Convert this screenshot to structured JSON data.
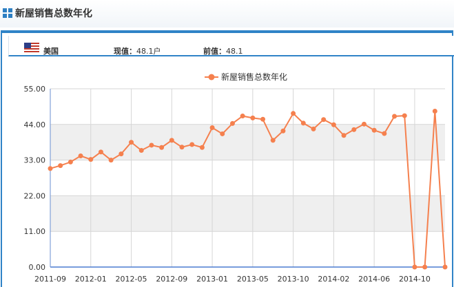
{
  "header": {
    "title": "新屋销售总数年化"
  },
  "info": {
    "country": "美国",
    "current_label": "现值",
    "current_sep": "：",
    "current_value": "48.1户",
    "previous_label": "前值",
    "previous_sep": "：",
    "previous_value": "48.1"
  },
  "chart_data": {
    "type": "line",
    "title": "",
    "xlabel": "",
    "ylabel": "",
    "ylim": [
      0,
      55
    ],
    "yticks": [
      "0.00",
      "11.00",
      "22.00",
      "33.00",
      "44.00",
      "55.00"
    ],
    "xtick_labels": [
      "2011-09",
      "2012-01",
      "2012-05",
      "2012-09",
      "2013-01",
      "2013-05",
      "2013-10",
      "2014-02",
      "2014-06",
      "2014-10"
    ],
    "legend_position": "top-center",
    "grid": true,
    "series_color": "#f5804e",
    "series": [
      {
        "name": "新屋销售总数年化",
        "x": [
          "2011-09",
          "2011-10",
          "2011-11",
          "2011-12",
          "2012-01",
          "2012-02",
          "2012-03",
          "2012-04",
          "2012-05",
          "2012-06",
          "2012-07",
          "2012-08",
          "2012-09",
          "2012-10",
          "2012-11",
          "2012-12",
          "2013-01",
          "2013-02",
          "2013-03",
          "2013-04",
          "2013-05",
          "2013-06",
          "2013-07",
          "2013-08",
          "2013-10",
          "2013-11",
          "2013-12",
          "2014-01",
          "2014-02",
          "2014-03",
          "2014-04",
          "2014-05",
          "2014-06",
          "2014-07",
          "2014-08",
          "2014-09",
          "2014-10",
          "2014-11",
          "2014-12",
          "2015-01"
        ],
        "values": [
          30.4,
          31.3,
          32.4,
          34.3,
          33.2,
          35.5,
          33.0,
          34.9,
          38.5,
          36.0,
          37.6,
          36.9,
          39.1,
          37.0,
          37.8,
          36.9,
          43.0,
          41.1,
          44.3,
          46.6,
          46.0,
          45.6,
          39.1,
          42.0,
          47.4,
          44.4,
          42.6,
          45.5,
          43.9,
          40.6,
          42.4,
          44.1,
          42.2,
          41.2,
          46.5,
          46.7,
          0,
          0,
          48.1,
          0
        ]
      }
    ]
  }
}
